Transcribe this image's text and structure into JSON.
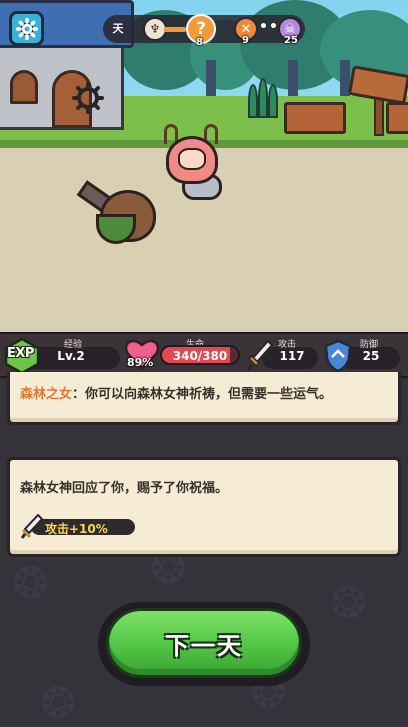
{
  "hud": {
    "day_label": "天",
    "day_stages": [
      {
        "icon": "trophy-icon",
        "number": ""
      },
      {
        "icon": "question-icon",
        "number": "8"
      },
      {
        "icon": "crossed-swords-icon",
        "number": "9"
      },
      {
        "icon": "skull-icon",
        "number": "25"
      }
    ],
    "ellipsis": "•••"
  },
  "stats": {
    "exp": {
      "badge": "EXP",
      "title": "经验",
      "value": "Lv.2"
    },
    "hp": {
      "title": "生命",
      "value": "340/380",
      "percent_label": "89%",
      "fill_fraction": 0.89
    },
    "attack": {
      "title": "攻击",
      "value": "117"
    },
    "defense": {
      "title": "防御",
      "value": "25"
    }
  },
  "dialog": {
    "speaker": "森林之女",
    "line": "：你可以向森林女神祈祷，但需要一些运气。"
  },
  "result": {
    "line": "森林女神回应了你，赐予了你祝福。",
    "buff": "攻击+10%"
  },
  "next_button": "下一天",
  "colors": {
    "accent_orange": "#e0782e",
    "button_green": "#52c443",
    "hp_red": "#e14850",
    "buff_yellow": "#ffd84a"
  }
}
